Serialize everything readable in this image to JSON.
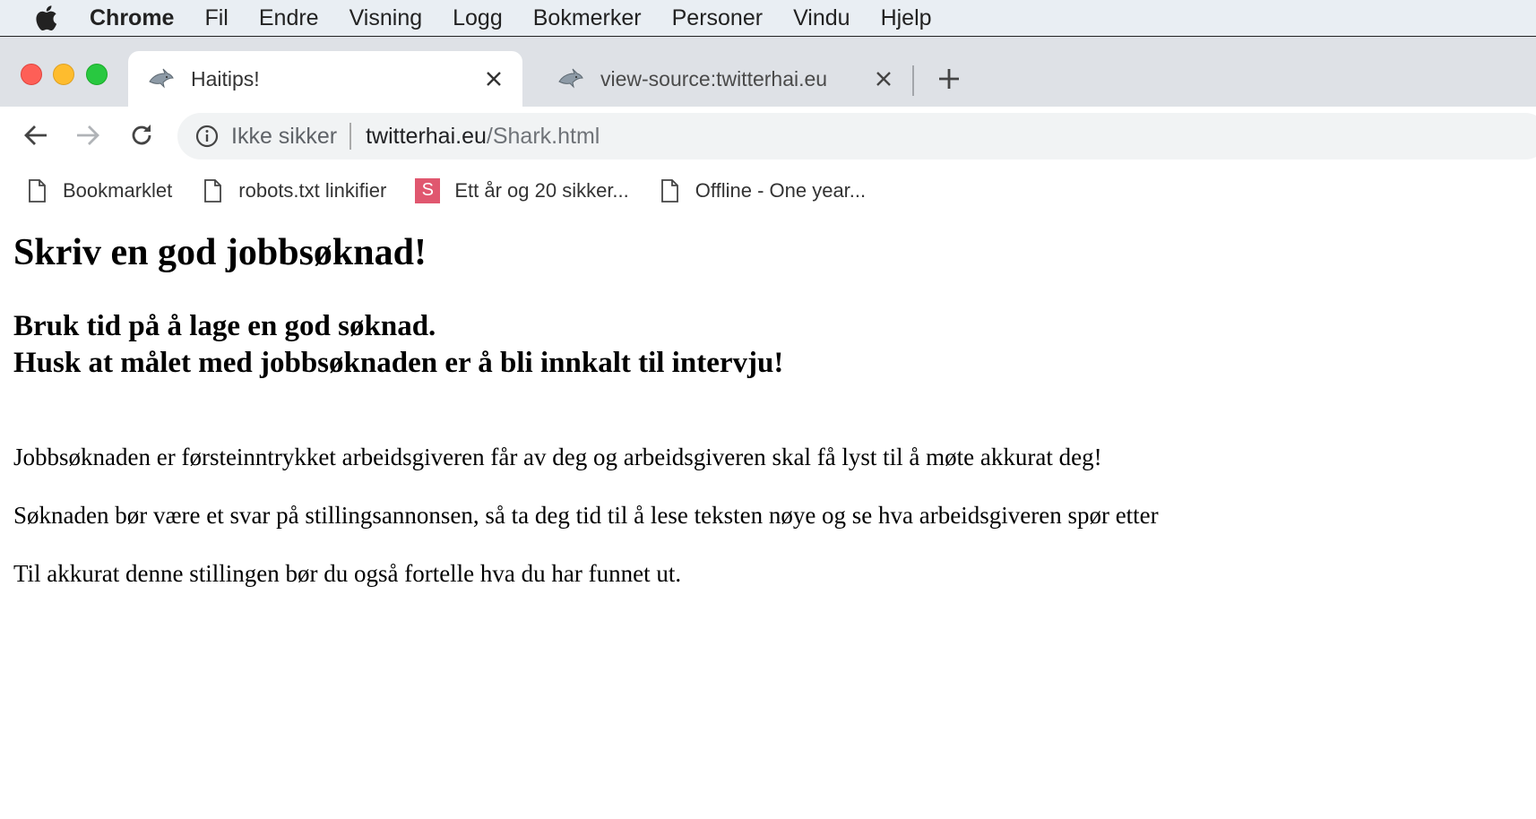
{
  "menubar": {
    "app": "Chrome",
    "items": [
      "Fil",
      "Endre",
      "Visning",
      "Logg",
      "Bokmerker",
      "Personer",
      "Vindu",
      "Hjelp"
    ]
  },
  "tabs": [
    {
      "title": "Haitips!",
      "active": true,
      "icon": "shark-favicon"
    },
    {
      "title": "view-source:twitterhai.eu",
      "active": false,
      "icon": "shark-favicon"
    }
  ],
  "omnibox": {
    "security_label": "Ikke sikker",
    "host": "twitterhai.eu",
    "path": "/Shark.html"
  },
  "bookmarks": [
    {
      "label": "Bookmarklet",
      "icon": "page-icon"
    },
    {
      "label": "robots.txt linkifier",
      "icon": "page-icon"
    },
    {
      "label": "Ett år og 20 sikker...",
      "icon": "s-favicon",
      "icon_text": "S"
    },
    {
      "label": "Offline - One year...",
      "icon": "page-icon"
    }
  ],
  "page": {
    "heading": "Skriv en god jobbsøknad!",
    "subheading_lines": [
      "Bruk tid på å lage en god søknad.",
      "Husk at målet med jobbsøknaden er å bli innkalt til intervju!"
    ],
    "paragraphs": [
      "Jobbsøknaden er førsteinntrykket arbeidsgiveren får av deg og arbeidsgiveren skal få lyst til å møte akkurat deg!",
      "Søknaden bør være et svar på stillingsannonsen, så ta deg tid til å lese teksten nøye og se hva arbeidsgiveren spør etter",
      "Til akkurat denne stillingen bør du også fortelle hva du har funnet ut."
    ]
  },
  "colors": {
    "menubar_bg": "#e9eef3",
    "tabstrip_bg": "#dee1e6",
    "omnibox_bg": "#f1f3f4",
    "s_favicon": "#e0576f"
  }
}
